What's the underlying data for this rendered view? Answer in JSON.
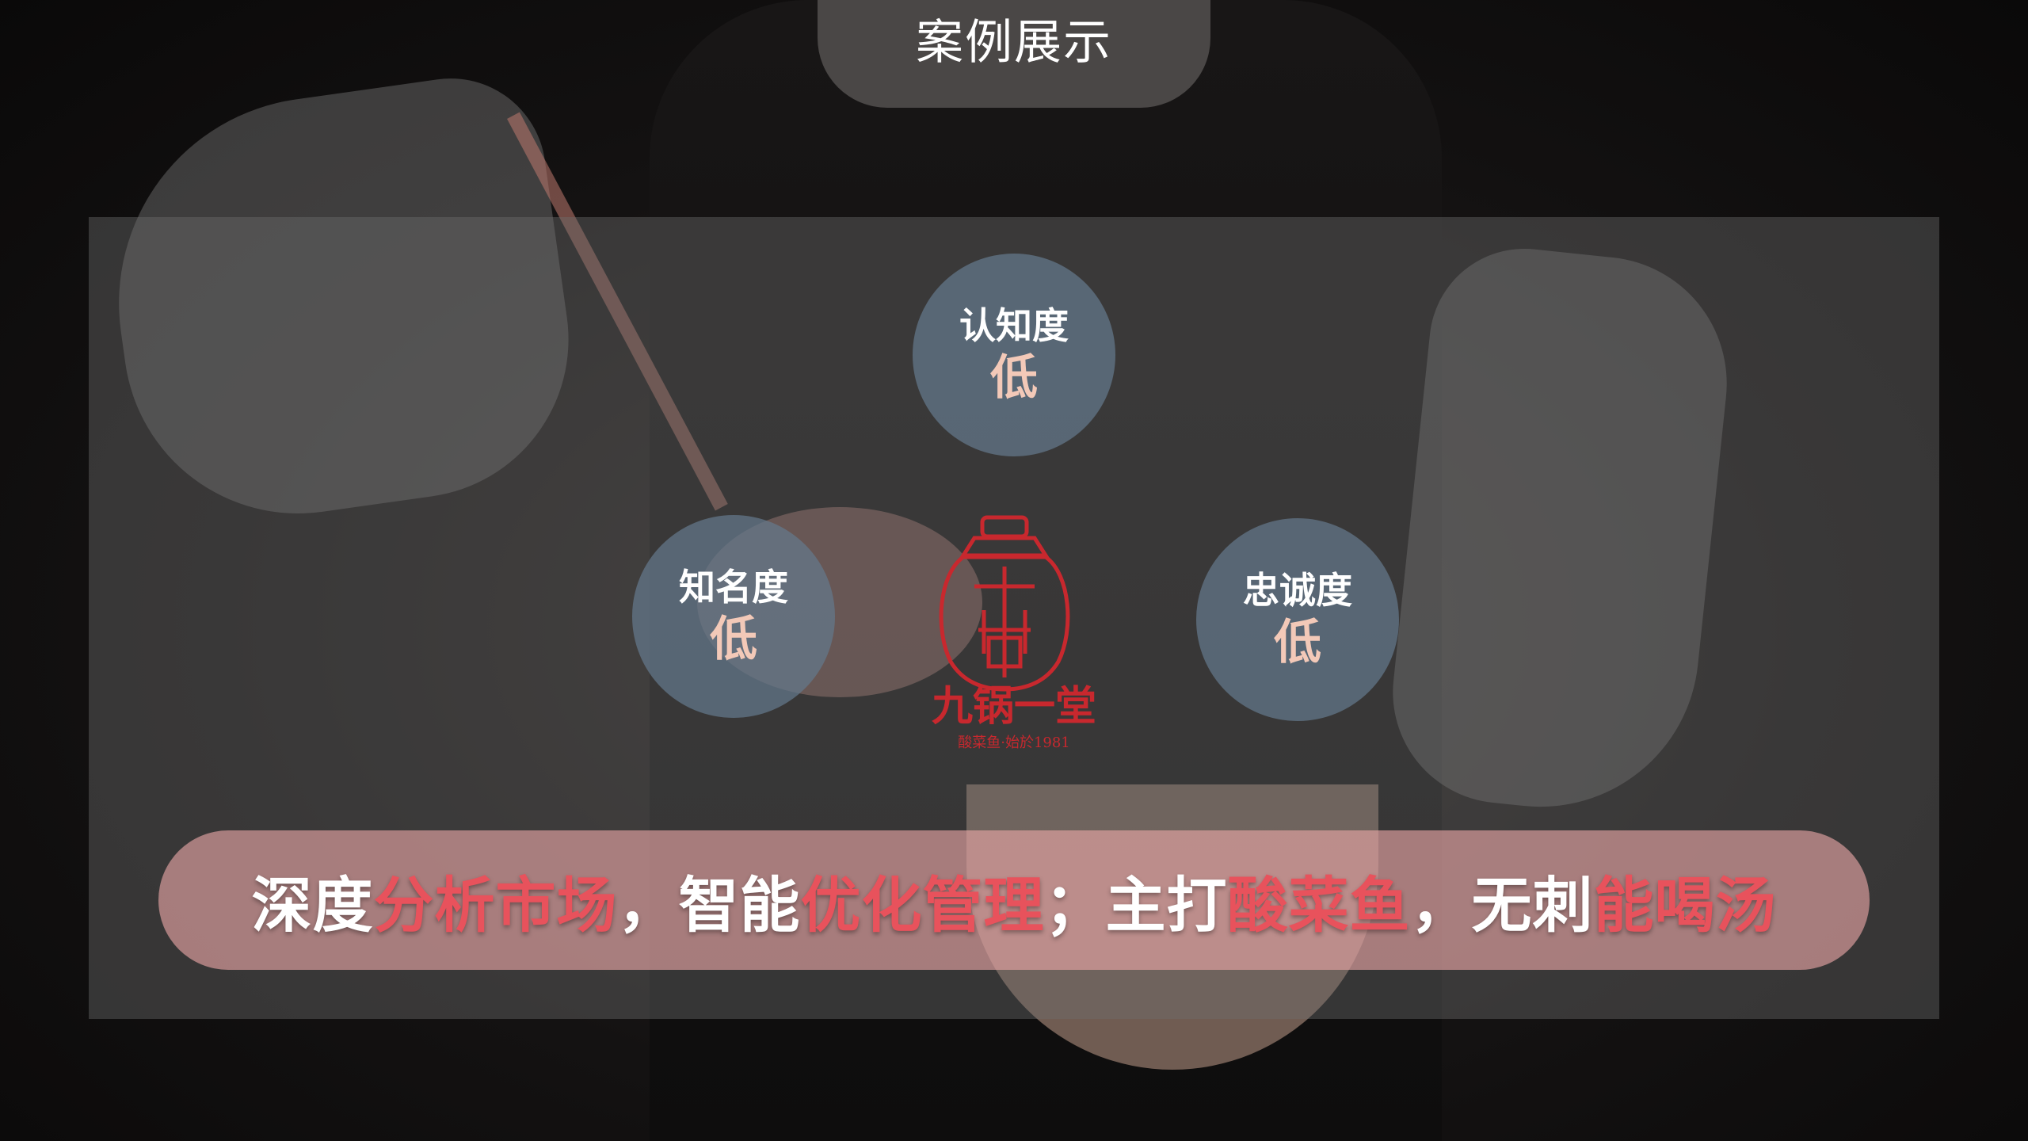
{
  "page": {
    "title": "案例展示"
  },
  "bubbles": [
    {
      "label": "认知度",
      "value": "低"
    },
    {
      "label": "知名度",
      "value": "低"
    },
    {
      "label": "忠诚度",
      "value": "低"
    }
  ],
  "logo": {
    "name": "九锅一堂",
    "tagline": "酸菜鱼·始於1981"
  },
  "slogan": [
    {
      "text": "深度",
      "color": "white"
    },
    {
      "text": "分析市场",
      "color": "red"
    },
    {
      "text": "，智能",
      "color": "white"
    },
    {
      "text": "优化管理",
      "color": "red"
    },
    {
      "text": "；主打",
      "color": "white"
    },
    {
      "text": "酸菜鱼",
      "color": "red"
    },
    {
      "text": "，无刺",
      "color": "white"
    },
    {
      "text": "能喝汤",
      "color": "red"
    }
  ],
  "colors": {
    "accent_red": "#e8525c",
    "slogan_bg": "#eca8a8",
    "bubble_bg": "#64788c"
  }
}
